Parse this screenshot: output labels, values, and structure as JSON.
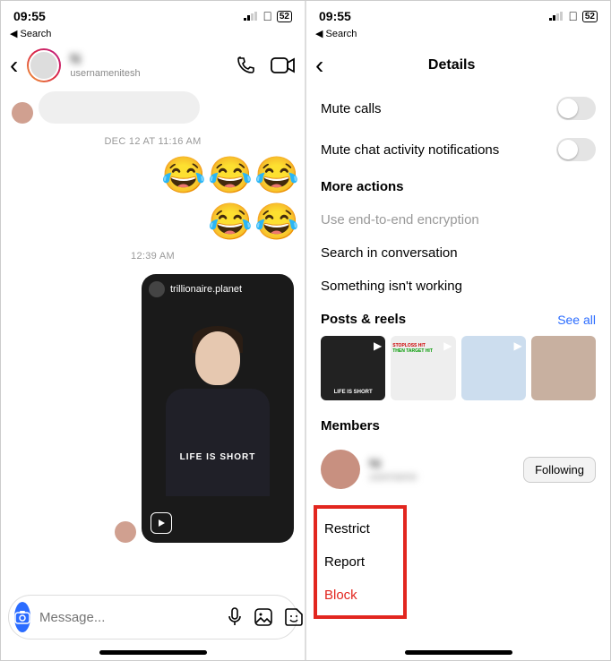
{
  "status": {
    "time": "09:55",
    "battery": "52",
    "back_label": "Search"
  },
  "left": {
    "header": {
      "name": "N",
      "subtitle": "usernamenitesh"
    },
    "timestamps": {
      "t1": "DEC 12 AT 11:16 AM",
      "t2": "12:39 AM"
    },
    "reel": {
      "author": "trillionaire.planet",
      "caption": "LIFE IS SHORT"
    },
    "compose": {
      "placeholder": "Message..."
    }
  },
  "right": {
    "title": "Details",
    "settings": {
      "mute_calls": "Mute calls",
      "mute_chat": "Mute chat activity notifications",
      "more_actions": "More actions",
      "e2e": "Use end-to-end encryption",
      "search": "Search in conversation",
      "notworking": "Something isn't working"
    },
    "posts": {
      "heading": "Posts & reels",
      "see_all": "See all",
      "thumb1_caption": "LIFE IS SHORT"
    },
    "members": {
      "heading": "Members",
      "name": "Ni",
      "sub": "username",
      "follow": "Following"
    },
    "actions": {
      "restrict": "Restrict",
      "report": "Report",
      "block": "Block"
    }
  }
}
